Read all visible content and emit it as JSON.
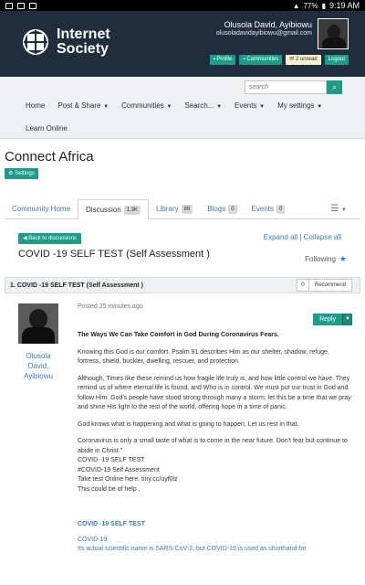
{
  "statusbar": {
    "battery": "77%",
    "time": "9:19 AM"
  },
  "header": {
    "logo_text_1": "Internet",
    "logo_text_2": "Society",
    "user_name": "Olusola David, Ayibiowu",
    "user_email": "olusoladavidayibiowu@gmail.com",
    "buttons": {
      "profile": "Profile",
      "communities": "Communities",
      "unread": "2 unread",
      "logout": "Logout"
    }
  },
  "nav": {
    "search_placeholder": "search",
    "items": [
      "Home",
      "Post & Share",
      "Communities",
      "Search...",
      "Events",
      "My settings"
    ],
    "learn_online": "Learn Online"
  },
  "community": {
    "title": "Connect Africa",
    "settings": "Settings"
  },
  "tabs": [
    {
      "label": "Community Home",
      "count": ""
    },
    {
      "label": "Discussion",
      "count": "1.3K"
    },
    {
      "label": "Library",
      "count": "86"
    },
    {
      "label": "Blogs",
      "count": "0"
    },
    {
      "label": "Events",
      "count": "0"
    }
  ],
  "thread": {
    "back_label": "Back to discussions",
    "expand_all": "Expand all",
    "separator": " | ",
    "collapse_all": "Collapse all",
    "title": "COVID -19 SELF TEST (Self Assessment )",
    "following": "Following"
  },
  "post": {
    "bar_title": "1.  COVID -19 SELF TEST (Self Assessment )",
    "rec_count": "0",
    "recommend": "Recommend",
    "author": "Olusola David, Ayibiowu",
    "posted": "Posted 25 minutes ago",
    "reply": "Reply",
    "heading": "The Ways We Can Take Comfort in God During Coronavirus Fears.",
    "para1": "Knowing this God is our comfort. Psalm 91 describes Him as our shelter, shadow, refuge, fortress, shield, buckler, dwelling, rescuer, and protection.",
    "para2": "Although, Times like these remind us how fragile life truly is, and how little control we have. They remind us of where eternal life is found, and Who is in control. We must put our trust in God and follow Him. God's people have stood strong through many a storm; let this be a time that we pray and shine His light to the rest of the world, offering hope in a time of panic.",
    "para3": "God knows what is happening and what is going to happen, Let us rest in that.",
    "para4": "Coronavirus is only a small taste of what is to come in the near future. Don't fear but continue to abide in Christ.\"",
    "line1": "COVID -19 SELF TEST",
    "line2": "#COVID-19 Self Assessment",
    "line3": "Take test Online here. tiny.cc/uyf0lz",
    "line4": "This could be of help ,",
    "link_title": "COVID -19 SELF TEST",
    "link_sub": "COVID-19",
    "link_desc": "Its actual scientific name is SARS-CoV-2, but COVID-19 is used as shorthand for"
  }
}
